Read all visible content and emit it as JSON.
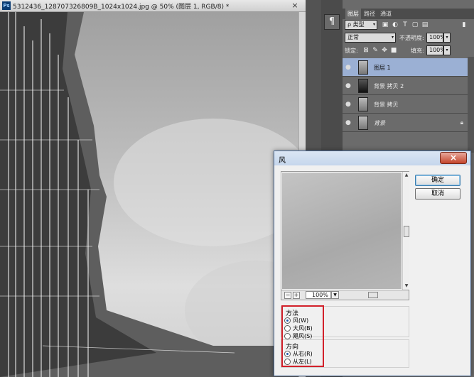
{
  "document": {
    "app_badge": "Ps",
    "title": "5312436_128707326809B_1024x1024.jpg @ 50% (图层 1, RGB/8) *",
    "close_glyph": "×"
  },
  "panel": {
    "paragraph_glyph": "¶",
    "tabs": [
      "图层",
      "路径",
      "通道"
    ],
    "kind_label": "ρ 类型",
    "blend_mode": "正常",
    "opacity_label": "不透明度:",
    "opacity_value": "100%",
    "lock_label": "锁定:",
    "fill_label": "填充:",
    "fill_value": "100%",
    "layers": [
      {
        "name": "图层 1",
        "selected": true
      },
      {
        "name": "背景 拷贝 2",
        "selected": false
      },
      {
        "name": "背景 拷贝",
        "selected": false
      },
      {
        "name": "背景",
        "selected": false,
        "locked": true
      }
    ]
  },
  "dialog": {
    "title": "风",
    "close_glyph": "×",
    "ok_label": "确定",
    "cancel_label": "取消",
    "zoom_minus": "−",
    "zoom_plus": "+",
    "zoom_level": "100%",
    "method": {
      "title": "方法",
      "options": [
        "风(W)",
        "大风(B)",
        "飓风(S)"
      ],
      "selected": 0
    },
    "direction": {
      "title": "方向",
      "options": [
        "从右(R)",
        "从左(L)"
      ],
      "selected": 0
    }
  },
  "colors": {
    "highlight": "#d2202a",
    "selected_layer": "#9bb0d4"
  }
}
